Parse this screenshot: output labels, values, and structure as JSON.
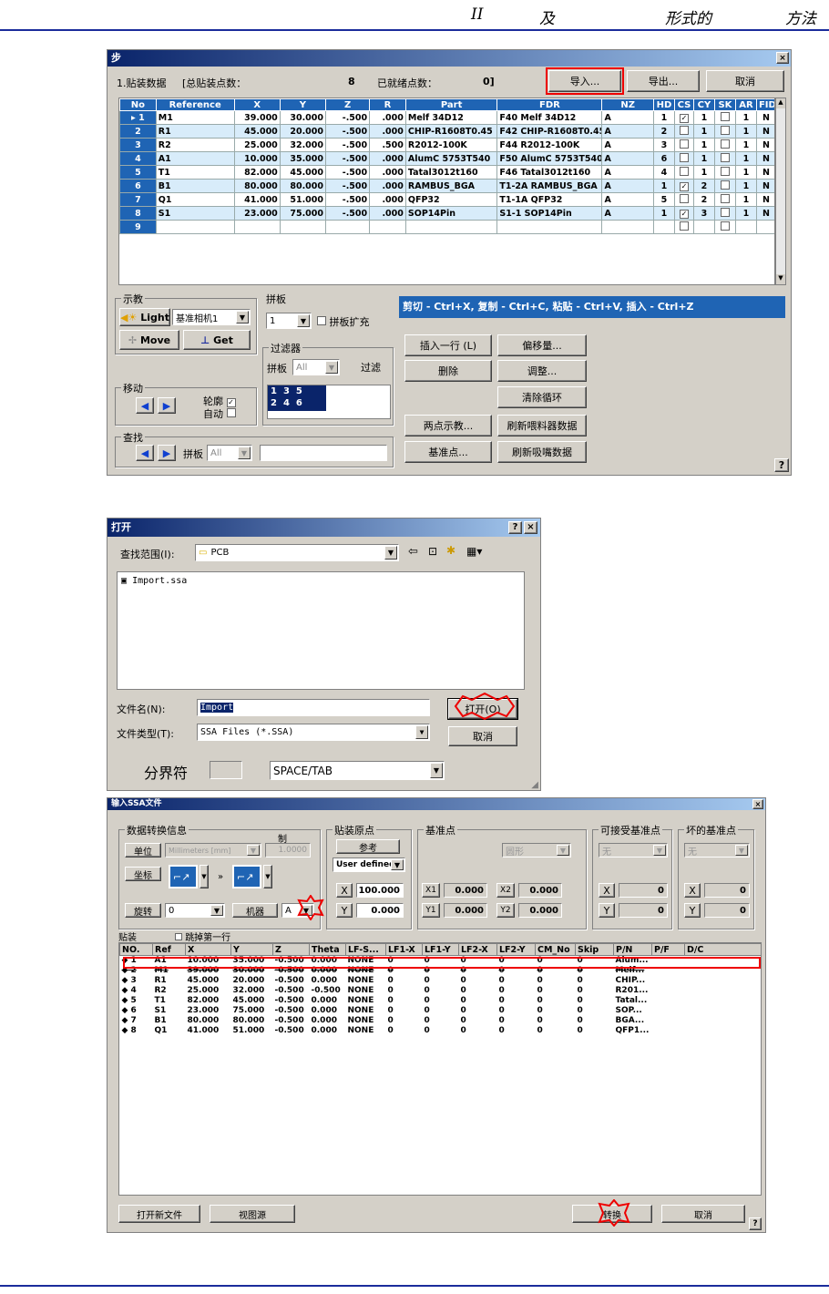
{
  "header": {
    "c1": "II",
    "c2": "及",
    "c3": "形式的",
    "c4": "方法"
  },
  "accent": "#1f64b4",
  "win1": {
    "title": "步",
    "section": "1.贴装数据",
    "total_label": "[总贴装点数：",
    "total_value": "8",
    "done_label": "已就绪点数：",
    "done_value": "0]",
    "import_btn": "导入...",
    "export_btn": "导出...",
    "cancel_btn": "取消",
    "columns": [
      "No",
      "Reference",
      "X",
      "Y",
      "Z",
      "R",
      "Part",
      "FDR",
      "NZ",
      "HD",
      "CS",
      "CY",
      "SK",
      "AR",
      "FID"
    ],
    "rows": [
      {
        "no": "1",
        "ref": "M1",
        "x": "39.000",
        "y": "30.000",
        "z": "-.500",
        "r": ".000",
        "part": "Melf 34D12",
        "fdr": "F40 Melf 34D12",
        "nz": "A",
        "hd": "1",
        "cs": "✓",
        "cy": "1",
        "sk": "",
        "ar": "1",
        "fid": "N"
      },
      {
        "no": "2",
        "ref": "R1",
        "x": "45.000",
        "y": "20.000",
        "z": "-.500",
        "r": ".000",
        "part": "CHIP-R1608T0.45",
        "fdr": "F42 CHIP-R1608T0.45",
        "nz": "A",
        "hd": "2",
        "cs": "",
        "cy": "1",
        "sk": "",
        "ar": "1",
        "fid": "N"
      },
      {
        "no": "3",
        "ref": "R2",
        "x": "25.000",
        "y": "32.000",
        "z": "-.500",
        "r": ".500",
        "part": "R2012-100K",
        "fdr": "F44 R2012-100K",
        "nz": "A",
        "hd": "3",
        "cs": "",
        "cy": "1",
        "sk": "",
        "ar": "1",
        "fid": "N"
      },
      {
        "no": "4",
        "ref": "A1",
        "x": "10.000",
        "y": "35.000",
        "z": "-.500",
        "r": ".000",
        "part": "AlumC 5753T540",
        "fdr": "F50 AlumC 5753T540",
        "nz": "A",
        "hd": "6",
        "cs": "",
        "cy": "1",
        "sk": "",
        "ar": "1",
        "fid": "N"
      },
      {
        "no": "5",
        "ref": "T1",
        "x": "82.000",
        "y": "45.000",
        "z": "-.500",
        "r": ".000",
        "part": "Tatal3012t160",
        "fdr": "F46 Tatal3012t160",
        "nz": "A",
        "hd": "4",
        "cs": "",
        "cy": "1",
        "sk": "",
        "ar": "1",
        "fid": "N"
      },
      {
        "no": "6",
        "ref": "B1",
        "x": "80.000",
        "y": "80.000",
        "z": "-.500",
        "r": ".000",
        "part": "RAMBUS_BGA",
        "fdr": "T1-2A RAMBUS_BGA",
        "nz": "A",
        "hd": "1",
        "cs": "✓",
        "cy": "2",
        "sk": "",
        "ar": "1",
        "fid": "N"
      },
      {
        "no": "7",
        "ref": "Q1",
        "x": "41.000",
        "y": "51.000",
        "z": "-.500",
        "r": ".000",
        "part": "QFP32",
        "fdr": "T1-1A QFP32",
        "nz": "A",
        "hd": "5",
        "cs": "",
        "cy": "2",
        "sk": "",
        "ar": "1",
        "fid": "N"
      },
      {
        "no": "8",
        "ref": "S1",
        "x": "23.000",
        "y": "75.000",
        "z": "-.500",
        "r": ".000",
        "part": "SOP14Pin",
        "fdr": "S1-1 SOP14Pin",
        "nz": "A",
        "hd": "1",
        "cs": "✓",
        "cy": "3",
        "sk": "",
        "ar": "1",
        "fid": "N"
      },
      {
        "no": "9",
        "ref": "",
        "x": "",
        "y": "",
        "z": "",
        "r": "",
        "part": "",
        "fdr": "",
        "nz": "",
        "hd": "",
        "cs": "",
        "cy": "",
        "sk": "",
        "ar": "",
        "fid": ""
      }
    ],
    "teach": {
      "legend": "示教",
      "light": "Light",
      "camera": "基准相机1",
      "move": "Move",
      "get": "Get"
    },
    "panel": {
      "legend": "拼板",
      "value": "1",
      "expand": "拼板扩充"
    },
    "filter": {
      "legend": "过滤器",
      "label": "拼板",
      "value": "All",
      "btn": "过滤",
      "list": [
        "1",
        "3",
        "5",
        "2",
        "4",
        "6"
      ]
    },
    "movegrp": {
      "legend": "移动",
      "outline": "轮廓",
      "auto": "自动"
    },
    "find": {
      "legend": "查找",
      "label": "拼板",
      "value": "All"
    },
    "hint": "剪切 - Ctrl+X, 复制 - Ctrl+C, 粘贴 - Ctrl+V, 插入 - Ctrl+Z",
    "buttons": {
      "insert": "插入一行 (L)",
      "offset": "偏移量...",
      "delete": "删除",
      "adjust": "调整...",
      "clear": "清除循环",
      "twopoint": "两点示教...",
      "refresh_feeder": "刷新喂料器数据",
      "fiducial": "基准点...",
      "refresh_nozzle": "刷新吸嘴数据"
    },
    "help": "?"
  },
  "open": {
    "title": "打开",
    "help": "?",
    "close": "×",
    "lookin_label": "查找范围(I):",
    "lookin_value": "PCB",
    "file": "Import.ssa",
    "name_label": "文件名(N):",
    "name_value": "Import",
    "type_label": "文件类型(T):",
    "type_value": "SSA Files (*.SSA)",
    "open_btn": "打开(O)",
    "cancel_btn": "取消",
    "sep_label": "分界符",
    "sep_value": "SPACE/TAB"
  },
  "ssa": {
    "title": "输入SSA文件",
    "conv": {
      "legend": "数据转换信息",
      "unit_label": "单位",
      "unit_value": "Millimeters [mm]",
      "zhi": "制",
      "zhi_value": "1.0000",
      "coord_label": "坐标",
      "rot_label": "旋转",
      "rot_value": "0",
      "machine_label": "机器",
      "machine_value": "A"
    },
    "origin": {
      "legend": "贴装原点",
      "ref": "参考",
      "mode": "User defined",
      "x_label": "X",
      "x_value": "100.000",
      "y_label": "Y",
      "y_value": "0.000"
    },
    "fid": {
      "legend": "基准点",
      "type": "圆形",
      "x1": "0.000",
      "y1": "0.000",
      "x2": "0.000",
      "y2": "0.000",
      "x1l": "X1",
      "y1l": "Y1",
      "x2l": "X2",
      "y2l": "Y2"
    },
    "accept": {
      "legend": "可接受基准点",
      "value": "无",
      "x": "0",
      "y": "0"
    },
    "bad": {
      "legend": "坏的基准点",
      "value": "无",
      "x": "0",
      "y": "0"
    },
    "mount_label": "贴装",
    "skip_first": "跳掉第一行",
    "columns": [
      "NO.",
      "Ref",
      "X",
      "Y",
      "Z",
      "Theta",
      "LF-S...",
      "LF1-X",
      "LF1-Y",
      "LF2-X",
      "LF2-Y",
      "CM_No",
      "Skip",
      "P/N",
      "P/F",
      "D/C"
    ],
    "rows": [
      {
        "no": "◆ 1",
        "ref": "A1",
        "x": "10.000",
        "y": "35.000",
        "z": "-0.500",
        "t": "0.000",
        "lf": "NONE",
        "a": "0",
        "b": "0",
        "c": "0",
        "d": "0",
        "cm": "0",
        "sk": "0",
        "pn": "Alum..."
      },
      {
        "no": "◆ 2",
        "ref": "M1",
        "x": "39.000",
        "y": "30.000",
        "z": "-0.500",
        "t": "0.000",
        "lf": "NONE",
        "a": "0",
        "b": "0",
        "c": "0",
        "d": "0",
        "cm": "0",
        "sk": "0",
        "pn": "Melf..."
      },
      {
        "no": "◆ 3",
        "ref": "R1",
        "x": "45.000",
        "y": "20.000",
        "z": "-0.500",
        "t": "0.000",
        "lf": "NONE",
        "a": "0",
        "b": "0",
        "c": "0",
        "d": "0",
        "cm": "0",
        "sk": "0",
        "pn": "CHIP..."
      },
      {
        "no": "◆ 4",
        "ref": "R2",
        "x": "25.000",
        "y": "32.000",
        "z": "-0.500",
        "t": "-0.500",
        "lf": "NONE",
        "a": "0",
        "b": "0",
        "c": "0",
        "d": "0",
        "cm": "0",
        "sk": "0",
        "pn": "R201..."
      },
      {
        "no": "◆ 5",
        "ref": "T1",
        "x": "82.000",
        "y": "45.000",
        "z": "-0.500",
        "t": "0.000",
        "lf": "NONE",
        "a": "0",
        "b": "0",
        "c": "0",
        "d": "0",
        "cm": "0",
        "sk": "0",
        "pn": "Tatal..."
      },
      {
        "no": "◆ 6",
        "ref": "S1",
        "x": "23.000",
        "y": "75.000",
        "z": "-0.500",
        "t": "0.000",
        "lf": "NONE",
        "a": "0",
        "b": "0",
        "c": "0",
        "d": "0",
        "cm": "0",
        "sk": "0",
        "pn": "SOP..."
      },
      {
        "no": "◆ 7",
        "ref": "B1",
        "x": "80.000",
        "y": "80.000",
        "z": "-0.500",
        "t": "0.000",
        "lf": "NONE",
        "a": "0",
        "b": "0",
        "c": "0",
        "d": "0",
        "cm": "0",
        "sk": "0",
        "pn": "BGA..."
      },
      {
        "no": "◆ 8",
        "ref": "Q1",
        "x": "41.000",
        "y": "51.000",
        "z": "-0.500",
        "t": "0.000",
        "lf": "NONE",
        "a": "0",
        "b": "0",
        "c": "0",
        "d": "0",
        "cm": "0",
        "sk": "0",
        "pn": "QFP1..."
      }
    ],
    "open_new": "打开新文件",
    "view": "视图源",
    "convert": "转换",
    "cancel": "取消",
    "help": "?"
  }
}
